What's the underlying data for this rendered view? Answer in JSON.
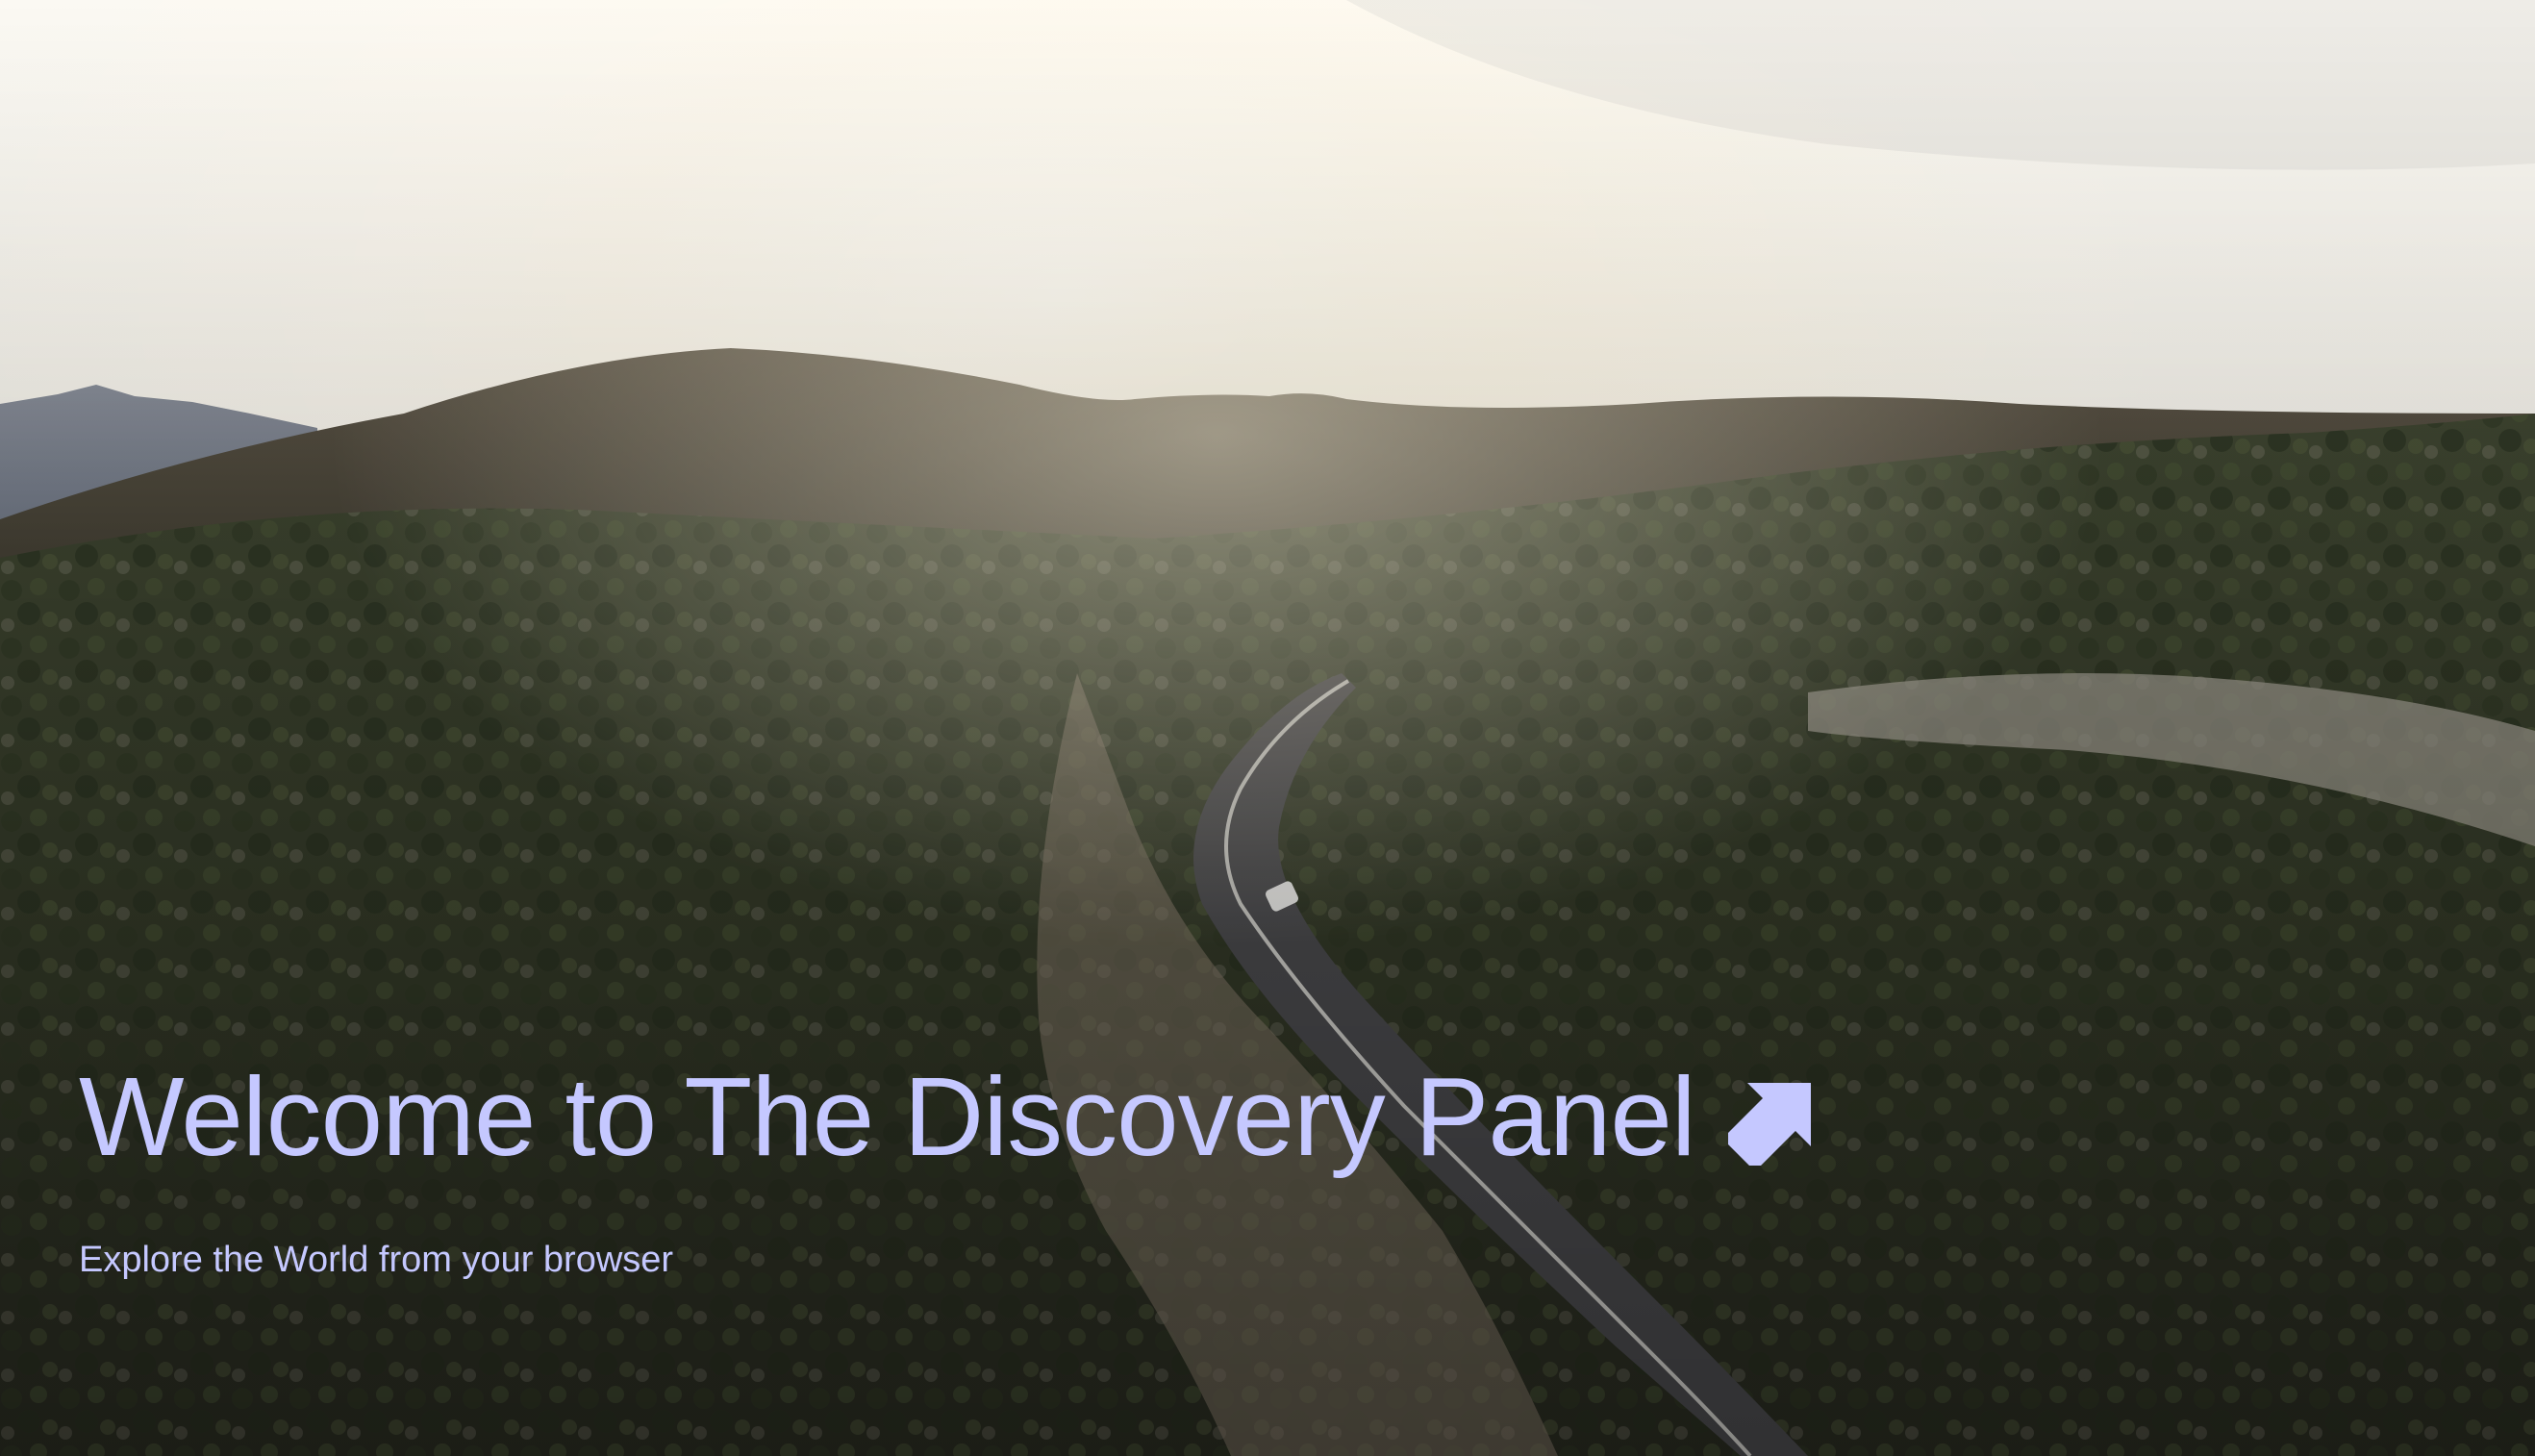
{
  "hero": {
    "title": "Welcome to The Discovery Panel",
    "subtitle": "Explore the World from your browser",
    "link_icon": "arrow-up-right-icon",
    "background": "aerial-landscape-road-sunset"
  },
  "colors": {
    "text": "#c5c8ff",
    "sky": "#f7f3ea",
    "vegetation": "#3b4430",
    "road": "#4b4b4e"
  }
}
